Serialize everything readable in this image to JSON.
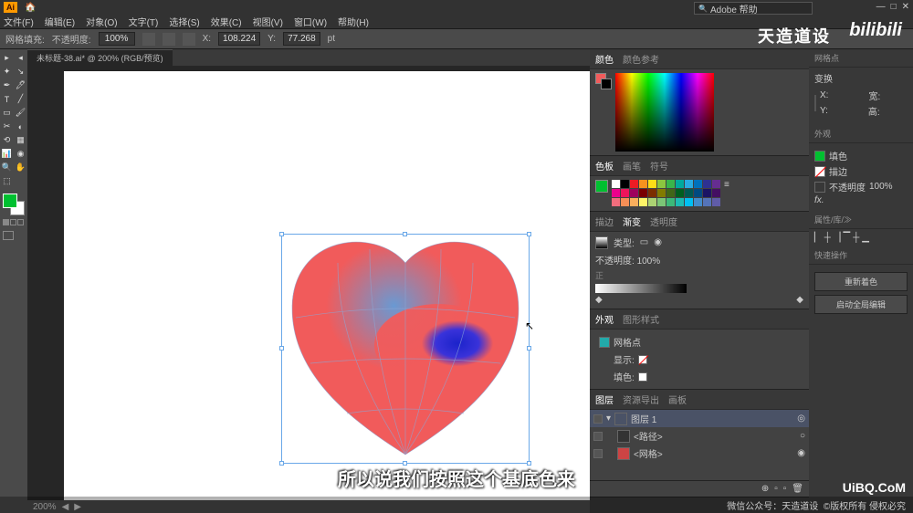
{
  "titlebar": {
    "app": "Ai",
    "home": "🏠"
  },
  "menu": [
    "文件(F)",
    "编辑(E)",
    "对象(O)",
    "文字(T)",
    "选择(S)",
    "效果(C)",
    "视图(V)",
    "窗口(W)",
    "帮助(H)"
  ],
  "search_placeholder": "Adobe 帮助",
  "ctrl": {
    "label": "网格填充:",
    "opacity_lbl": "不透明度:",
    "opacity": "100%",
    "x_lbl": "X:",
    "x": "108.224",
    "y_lbl": "Y:",
    "y": "77.268",
    "pt": "pt"
  },
  "tab": "未标题-38.ai* @ 200% (RGB/预览)",
  "status": {
    "zoom": "200%"
  },
  "tools_rows": [
    [
      "▸",
      "◂"
    ],
    [
      "✦",
      "↘"
    ],
    [
      "✒",
      "🖊"
    ],
    [
      "T",
      "╱"
    ],
    [
      "▭",
      "🖌"
    ],
    [
      "✂",
      "◐"
    ],
    [
      "⟲",
      "▦"
    ],
    [
      "📊",
      "◉"
    ],
    [
      "🔍",
      "✋"
    ],
    [
      "⬚",
      ""
    ]
  ],
  "swatch": {
    "fill": "#00c030",
    "stroke": "#ffffff"
  },
  "panels": {
    "color": {
      "tabs": [
        "颜色",
        "颜色参考"
      ]
    },
    "swatches": {
      "tabs": [
        "色板",
        "画笔",
        "符号"
      ],
      "colors": [
        [
          "#ffffff",
          "#000000",
          "#ed1c24",
          "#f7931e",
          "#ffde17",
          "#8cc63f",
          "#39b54a",
          "#00a99d",
          "#29abe2",
          "#0071bc",
          "#2e3192",
          "#662d91"
        ],
        [
          "#ec008c",
          "#ed145b",
          "#9e005d",
          "#790000",
          "#7b2e00",
          "#827b00",
          "#406618",
          "#005e20",
          "#005952",
          "#004a80",
          "#1b1464",
          "#440e62"
        ],
        [
          "#f26d7d",
          "#f68e56",
          "#fbaf5d",
          "#fff568",
          "#acd373",
          "#7cc576",
          "#3cb878",
          "#1cbbb4",
          "#00bff3",
          "#438ccb",
          "#5574b9",
          "#605ca8"
        ]
      ]
    },
    "gradient": {
      "tabs": [
        "描边",
        "渐变",
        "透明度"
      ],
      "type_lbl": "类型:",
      "opacity_lbl": "不透明度:",
      "opacity": "100%"
    },
    "appearance": {
      "tabs": [
        "外观",
        "图形样式"
      ],
      "item": "网格点",
      "fill_lbl": "显示:",
      "stroke_lbl": "填色:"
    },
    "layers": {
      "tabs": [
        "图层",
        "资源导出",
        "画板"
      ],
      "layer1": "图层 1",
      "obj1": "<路径>",
      "obj2": "<网格>"
    }
  },
  "right": {
    "anchor_hd": "网格点",
    "transform_hd": "变换",
    "x_lbl": "X:",
    "y_lbl": "Y:",
    "w_lbl": "宽:",
    "h_lbl": "高:",
    "appear_hd": "外观",
    "fill_lbl": "填色",
    "stroke_lbl": "描边",
    "op_lbl": "不透明度",
    "op": "100%",
    "fx": "fx.",
    "quick_hd": "快速操作",
    "recolor": "重新着色",
    "edit": "启动全局编辑",
    "align_hd": "属性/库/≫"
  },
  "watermarks": {
    "w1": "天造道设",
    "w2": "bilibili",
    "uibq": "UiBQ.CoM"
  },
  "subtitle": "所以说我们按照这个基底色来",
  "footer": {
    "wx": "微信公众号：天造道设",
    "copy": "©版权所有 侵权必究"
  },
  "winctl": [
    "—",
    "□",
    "✕"
  ]
}
